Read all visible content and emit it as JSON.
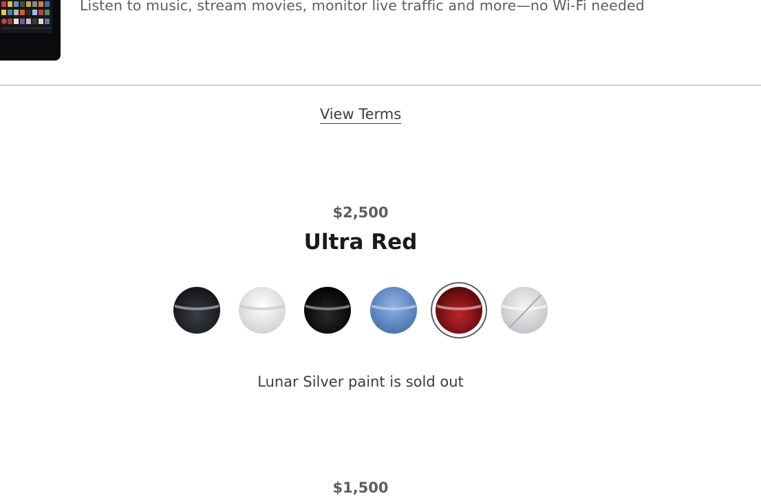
{
  "feature": {
    "description": "Listen to music, stream movies, monitor live traffic and more—no Wi-Fi needed"
  },
  "terms": {
    "label": "View Terms"
  },
  "paint": {
    "price": "$2,500",
    "selected_name": "Ultra Red",
    "sold_out_message": "Lunar Silver paint is sold out",
    "swatches": [
      {
        "color": "#2b2d33",
        "selected": false,
        "sold_out": false
      },
      {
        "color": "#eeeeee",
        "selected": false,
        "sold_out": false
      },
      {
        "color": "#141414",
        "selected": false,
        "sold_out": false
      },
      {
        "color": "#6b94cc",
        "selected": false,
        "sold_out": false
      },
      {
        "color": "#a3161b",
        "selected": true,
        "sold_out": false
      },
      {
        "color": "#dcdcde",
        "selected": false,
        "sold_out": true
      }
    ]
  },
  "next": {
    "price": "$1,500"
  }
}
